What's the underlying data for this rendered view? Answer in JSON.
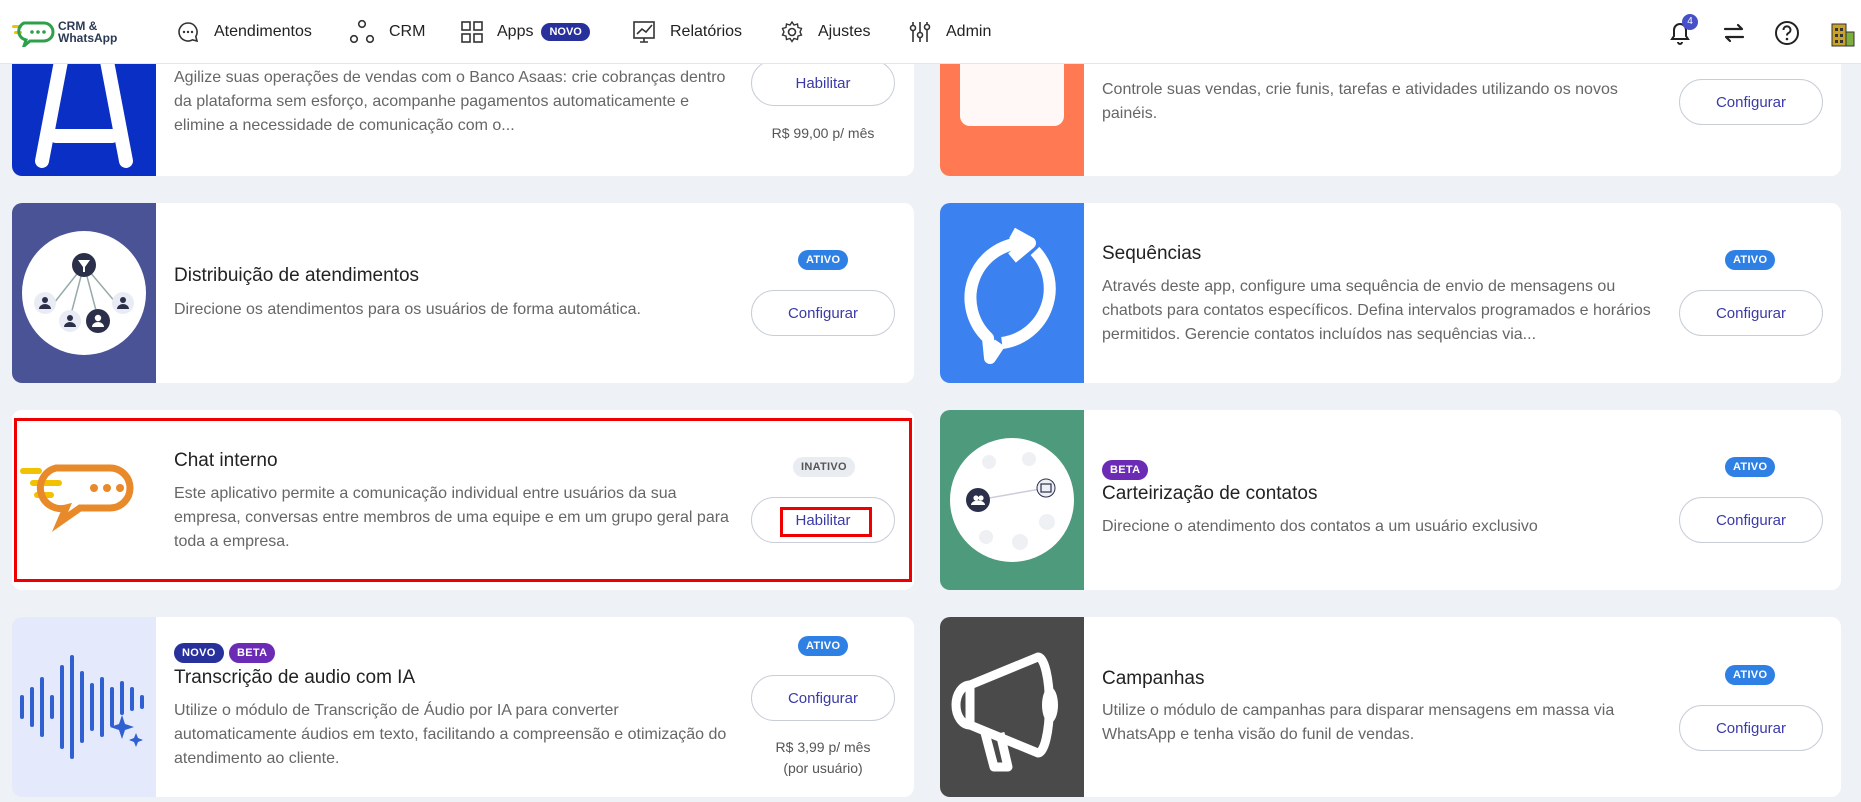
{
  "logo": {
    "line1": "CRM &",
    "line2": "WhatsApp"
  },
  "nav": [
    {
      "label": "Atendimentos",
      "icon": "chat-bubble-icon"
    },
    {
      "label": "CRM",
      "icon": "nodes-icon"
    },
    {
      "label": "Apps",
      "icon": "grid-icon",
      "badge": "NOVO"
    },
    {
      "label": "Relatórios",
      "icon": "chart-icon"
    },
    {
      "label": "Ajustes",
      "icon": "gear-icon"
    },
    {
      "label": "Admin",
      "icon": "sliders-icon"
    }
  ],
  "topbar_right": {
    "notifications_count": "4"
  },
  "cards": {
    "asaas": {
      "desc": "Agilize suas operações de vendas com o Banco Asaas: crie cobranças dentro da plataforma sem esforço, acompanhe pagamentos automaticamente e elimine a necessidade de comunicação com o...",
      "button": "Habilitar",
      "price": "R$ 99,00 p/ mês"
    },
    "paineis": {
      "desc": "Controle suas vendas, crie funis, tarefas e atividades utilizando os novos painéis.",
      "button": "Configurar"
    },
    "distribuicao": {
      "title": "Distribuição de atendimentos",
      "desc": "Direcione os atendimentos para os usuários de forma automática.",
      "status": "ATIVO",
      "button": "Configurar"
    },
    "sequencias": {
      "title": "Sequências",
      "desc": "Através deste app, configure uma sequência de envio de mensagens ou chatbots para contatos específicos. Defina intervalos programados e horários permitidos. Gerencie contatos incluídos nas sequências via...",
      "status": "ATIVO",
      "button": "Configurar"
    },
    "chat_interno": {
      "title": "Chat interno",
      "desc": "Este aplicativo permite a comunicação individual entre usuários da sua empresa, conversas entre membros de uma equipe e em um grupo geral para toda a empresa.",
      "status": "INATIVO",
      "button": "Habilitar"
    },
    "carteirizacao": {
      "badge": "BETA",
      "title": "Carteirização de contatos",
      "desc": "Direcione o atendimento dos contatos a um usuário exclusivo",
      "status": "ATIVO",
      "button": "Configurar"
    },
    "transcricao": {
      "badges": [
        "NOVO",
        "BETA"
      ],
      "title": "Transcrição de audio com IA",
      "desc": "Utilize o módulo de Transcrição de Áudio por IA para converter automaticamente áudios em texto, facilitando a compreensão e otimização do atendimento ao cliente.",
      "status": "ATIVO",
      "button": "Configurar",
      "price_line1": "R$ 3,99 p/ mês",
      "price_line2": "(por usuário)"
    },
    "campanhas": {
      "title": "Campanhas",
      "desc": "Utilize o módulo de campanhas para disparar mensagens em massa via WhatsApp e tenha visão do funil de vendas.",
      "status": "ATIVO",
      "button": "Configurar"
    }
  },
  "colors": {
    "asaas": "#0a2fc4",
    "paineis": "#ff7a52",
    "distribuicao": "#4a5396",
    "sequencias": "#3b82f0",
    "carteirizacao": "#4e9a7c",
    "transcricao": "#e4e9fb",
    "campanhas": "#4a4a4a",
    "accent": "#3a3aa8"
  }
}
